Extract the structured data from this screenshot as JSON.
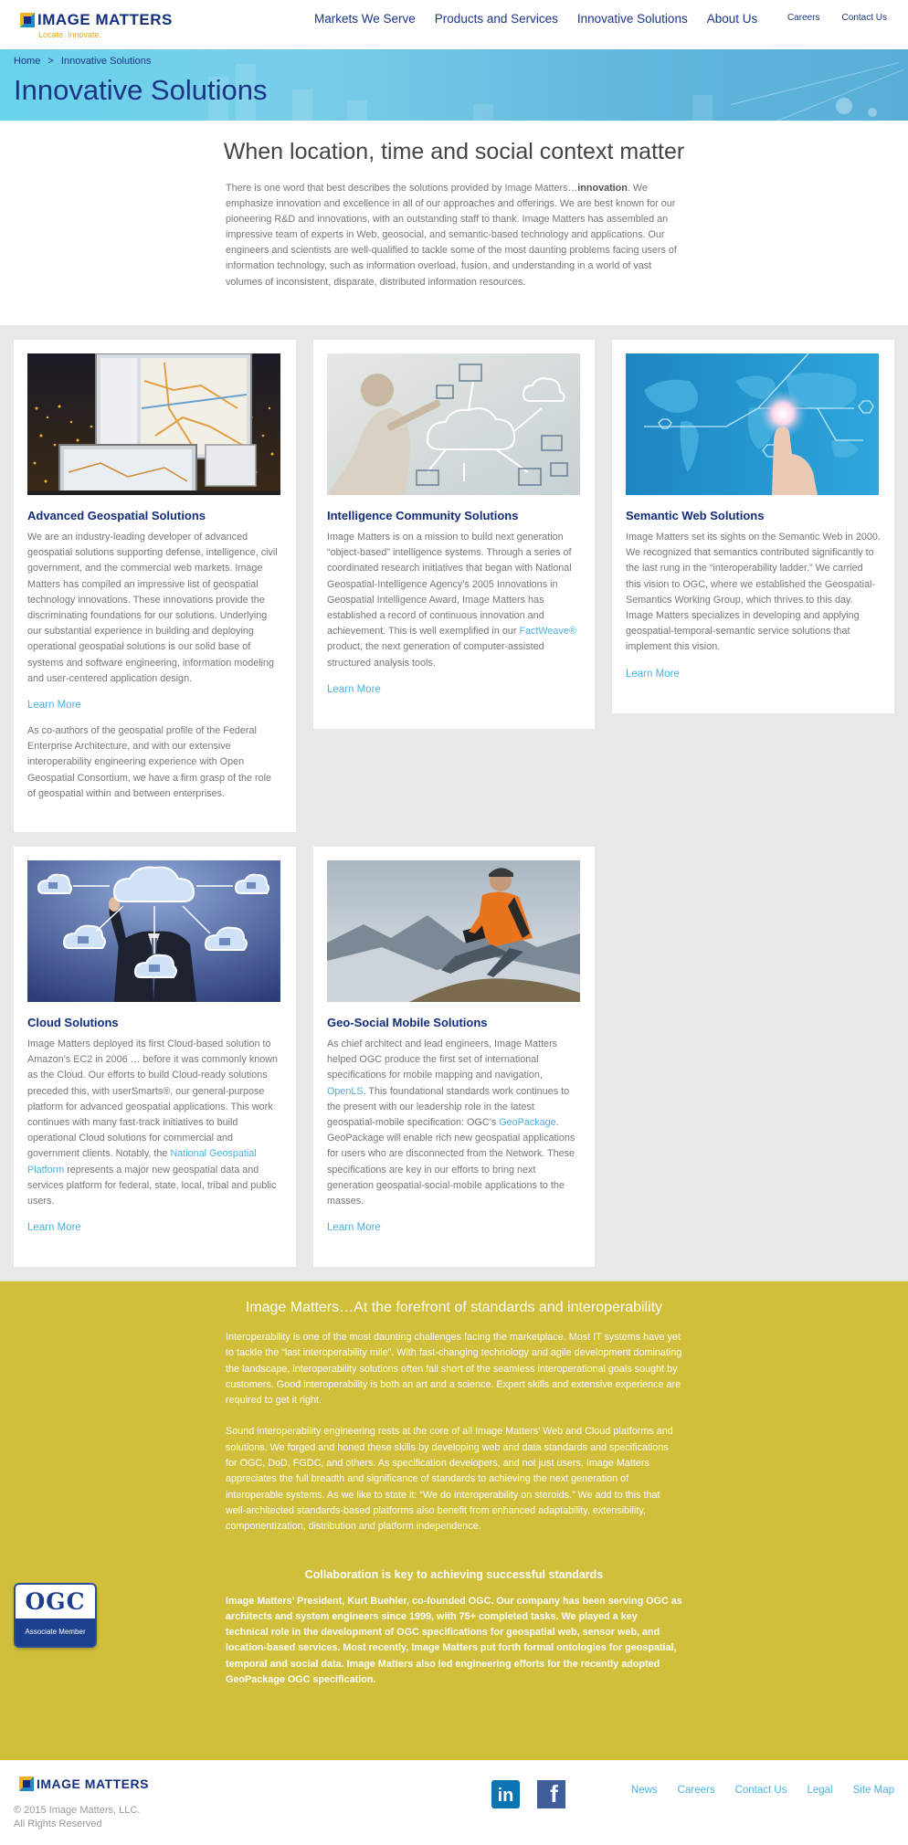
{
  "header": {
    "logo_text": "IMAGE MATTERS",
    "logo_tagline": "Locate.  Innovate.",
    "nav": [
      "Markets We Serve",
      "Products and Services",
      "Innovative Solutions",
      "About Us"
    ],
    "subnav": [
      "Careers",
      "Contact Us"
    ]
  },
  "banner": {
    "breadcrumb_home": "Home",
    "breadcrumb_sep": ">",
    "breadcrumb_current": "Innovative Solutions",
    "title": "Innovative Solutions"
  },
  "intro": {
    "heading": "When location, time and social context matter",
    "text_before": "There is one word that best describes the solutions provided by Image Matters…",
    "text_bold": "innovation",
    "text_after": ". We emphasize innovation and excellence in all of our approaches and offerings. We are best known for our pioneering R&D and innovations, with an outstanding staff to thank. Image Matters has assembled an impressive team of experts in Web, geosocial, and semantic-based technology and applications. Our engineers and scientists are well-qualified to tackle some of the most daunting problems facing users of information technology, such as information overload, fusion, and understanding in a world of vast volumes of inconsistent, disparate, distributed information resources."
  },
  "cards": {
    "geo": {
      "title": "Advanced Geospatial Solutions",
      "body": "We are an industry-leading developer of advanced geospatial solutions supporting defense, intelligence, civil government, and the commercial web markets. Image Matters has compiled an impressive list of geospatial technology innovations. These innovations provide the discriminating foundations for our solutions. Underlying our substantial experience in building and deploying operational geospatial solutions is our solid base of systems and software engineering, information modeling and user-centered application design.",
      "learn_more": "Learn More",
      "extra": "As co-authors of the geospatial profile of the Federal Enterprise Architecture, and with our extensive interoperability engineering experience with Open Geospatial Consortium, we have a firm grasp of the role of geospatial within and between enterprises."
    },
    "ic": {
      "title": "Intelligence Community Solutions",
      "body_before": "Image Matters is on a mission to build next generation “object-based” intelligence systems. Through a series of coordinated research initiatives that began with National Geospatial-Intelligence Agency’s 2005 Innovations in Geospatial Intelligence Award, Image Matters has established a record of continuous innovation and achievement. This is well exemplified in our ",
      "link": "FactWeave®",
      "body_after": " product, the next generation of computer-assisted structured analysis tools.",
      "learn_more": "Learn More"
    },
    "semantic": {
      "title": "Semantic Web Solutions",
      "body": "Image Matters set its sights on the Semantic Web in 2000. We recognized that semantics contributed significantly to the last rung in the “interoperability ladder.” We carried this vision to OGC, where we established the Geospatial-Semantics Working Group, which thrives to this day. Image Matters specializes in developing and applying geospatial-temporal-semantic service solutions that implement this vision.",
      "learn_more": "Learn More"
    },
    "cloud": {
      "title": "Cloud Solutions",
      "body_before": "Image Matters deployed its first Cloud-based solution to Amazon’s EC2 in 2006 … before it was commonly known as the Cloud. Our efforts to build Cloud-ready solutions preceded this, with userSmarts®, our general-purpose platform for advanced geospatial applications. This work continues with many fast-track initiatives to build operational Cloud solutions for commercial and government clients. Notably, the ",
      "link": "National Geospatial Platform",
      "body_after": " represents a major new geospatial data and services platform for federal, state, local, tribal and public users.",
      "learn_more": "Learn More"
    },
    "mobile": {
      "title": "Geo-Social Mobile Solutions",
      "body_1": "As chief architect and lead engineers, Image Matters helped OGC produce the first set of international specifications for mobile mapping and navigation, ",
      "link_1": "OpenLS",
      "body_2": ". This foundational standards work continues to the present with our leadership role in the latest geospatial-mobile specification: OGC’s ",
      "link_2": "GeoPackage",
      "body_3": ". GeoPackage will enable rich new geospatial applications for users who are disconnected from the Network. These specifications are key in our efforts to bring next generation geospatial-social-mobile applications to the masses.",
      "learn_more": "Learn More"
    }
  },
  "standards": {
    "heading": "Image Matters…At the forefront of standards and interoperability",
    "p1": "Interoperability is one of the most daunting challenges facing the marketplace. Most IT systems have yet to tackle the “last interoperability mile”. With fast-changing technology and agile development dominating the landscape, interoperability solutions often fall short of the seamless interoperational goals sought by customers. Good interoperability is both an art and a science. Expert skills and extensive experience are required to get it right.",
    "p2": "Sound interoperability engineering rests at the core of all Image Matters’ Web and Cloud platforms and solutions. We forged and honed these skills by developing web and data standards and specifications for OGC, DoD, FGDC, and others. As specification developers, and not just users, Image Matters appreciates the full breadth and significance of standards to achieving the next generation of interoperable systems. As we like to state it: “We do interoperability on steroids.” We add to this that well-architected standards-based platforms also benefit from enhanced adaptability, extensibility, componentization, distribution and platform independence.",
    "collab_heading": "Collaboration is key to achieving successful standards",
    "collab_text": "Image Matters’ President, Kurt Buehler, co-founded OGC. Our company has been serving OGC as architects and system engineers since 1999, with 75+ completed tasks. We played a key technical role in the development of OGC specifications for geospatial web, sensor web, and location-based services. Most recently, Image Matters put forth formal ontologies for geospatial, temporal and social data. Image Matters also led engineering efforts for the recently adopted GeoPackage OGC specification.",
    "ogc_badge_title": "OGC",
    "ogc_badge_sub": "Associate Member"
  },
  "footer": {
    "logo_text": "IMAGE MATTERS",
    "copyright": "© 2015 Image Matters, LLC.",
    "rights": "All Rights Reserved",
    "linkedin": "in",
    "facebook": "f",
    "nav": [
      "News",
      "Careers",
      "Contact Us",
      "Legal",
      "Site Map"
    ]
  }
}
